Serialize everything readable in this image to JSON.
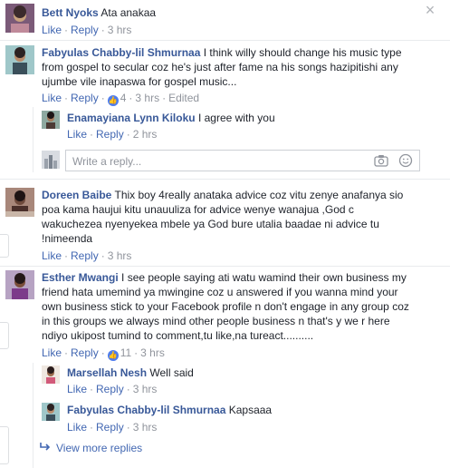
{
  "close_icon": "×",
  "comments": [
    {
      "author": "Bett Nyoks",
      "text": "Ata anakaa",
      "like_label": "Like",
      "reply_label": "Reply",
      "time": "3 hrs"
    },
    {
      "author": "Fabyulas Chabby-lil Shmurnaa",
      "text": "I think willy should change his music type from gospel to secular coz he's just after fame na his songs hazipitishi any ujumbe vile inapaswa for gospel music...",
      "like_label": "Like",
      "reply_label": "Reply",
      "reactions": "4",
      "time": "3 hrs",
      "edited": "Edited",
      "replies": [
        {
          "author": "Enamayiana Lynn Kiloku",
          "text": "I agree with you",
          "like_label": "Like",
          "reply_label": "Reply",
          "time": "2 hrs"
        }
      ],
      "reply_placeholder": "Write a reply..."
    },
    {
      "author": "Doreen Baibe",
      "text": "Thix boy 4really anataka advice coz vitu zenye anafanya sio poa kama haujui kitu unauuliza for advice wenye wanajua ,God c wakuchezea nyenyekea mbele ya God bure utalia baadae ni advice tu !nimeenda",
      "like_label": "Like",
      "reply_label": "Reply",
      "time": "3 hrs"
    },
    {
      "author": "Esther Mwangi",
      "text": "I see people saying ati watu wamind their own business my friend hata umemind ya mwingine coz u answered if you wanna mind your own business stick to your Facebook profile n don't engage in any group coz in this groups we always mind other people business n that's y we r here ndiyo ukipost tumind to comment,tu like,na tureact..........",
      "like_label": "Like",
      "reply_label": "Reply",
      "reactions": "11",
      "time": "3 hrs",
      "replies": [
        {
          "author": "Marsellah Nesh",
          "text": "Well said",
          "like_label": "Like",
          "reply_label": "Reply",
          "time": "3 hrs"
        },
        {
          "author": "Fabyulas Chabby-lil Shmurnaa",
          "text": "Kapsaaa",
          "like_label": "Like",
          "reply_label": "Reply",
          "time": "3 hrs"
        }
      ],
      "view_more": "View more replies"
    }
  ]
}
